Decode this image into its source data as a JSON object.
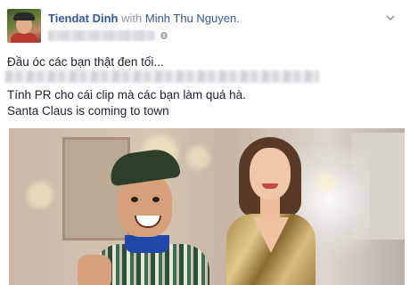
{
  "post": {
    "author": "Tiendat Dinh",
    "with_word": "with",
    "tagged": "Minh Thu Nguyen.",
    "lines": [
      "Đầu óc các bạn thật đen tối...",
      "Tính PR cho cái clip mà các bạn làm quá hà.",
      "Santa Claus is coming to town"
    ]
  },
  "icons": {
    "globe": "globe-icon",
    "caret": "chevron-down-icon"
  },
  "colors": {
    "link": "#365899",
    "muted": "#90949c",
    "text": "#1d2129"
  }
}
